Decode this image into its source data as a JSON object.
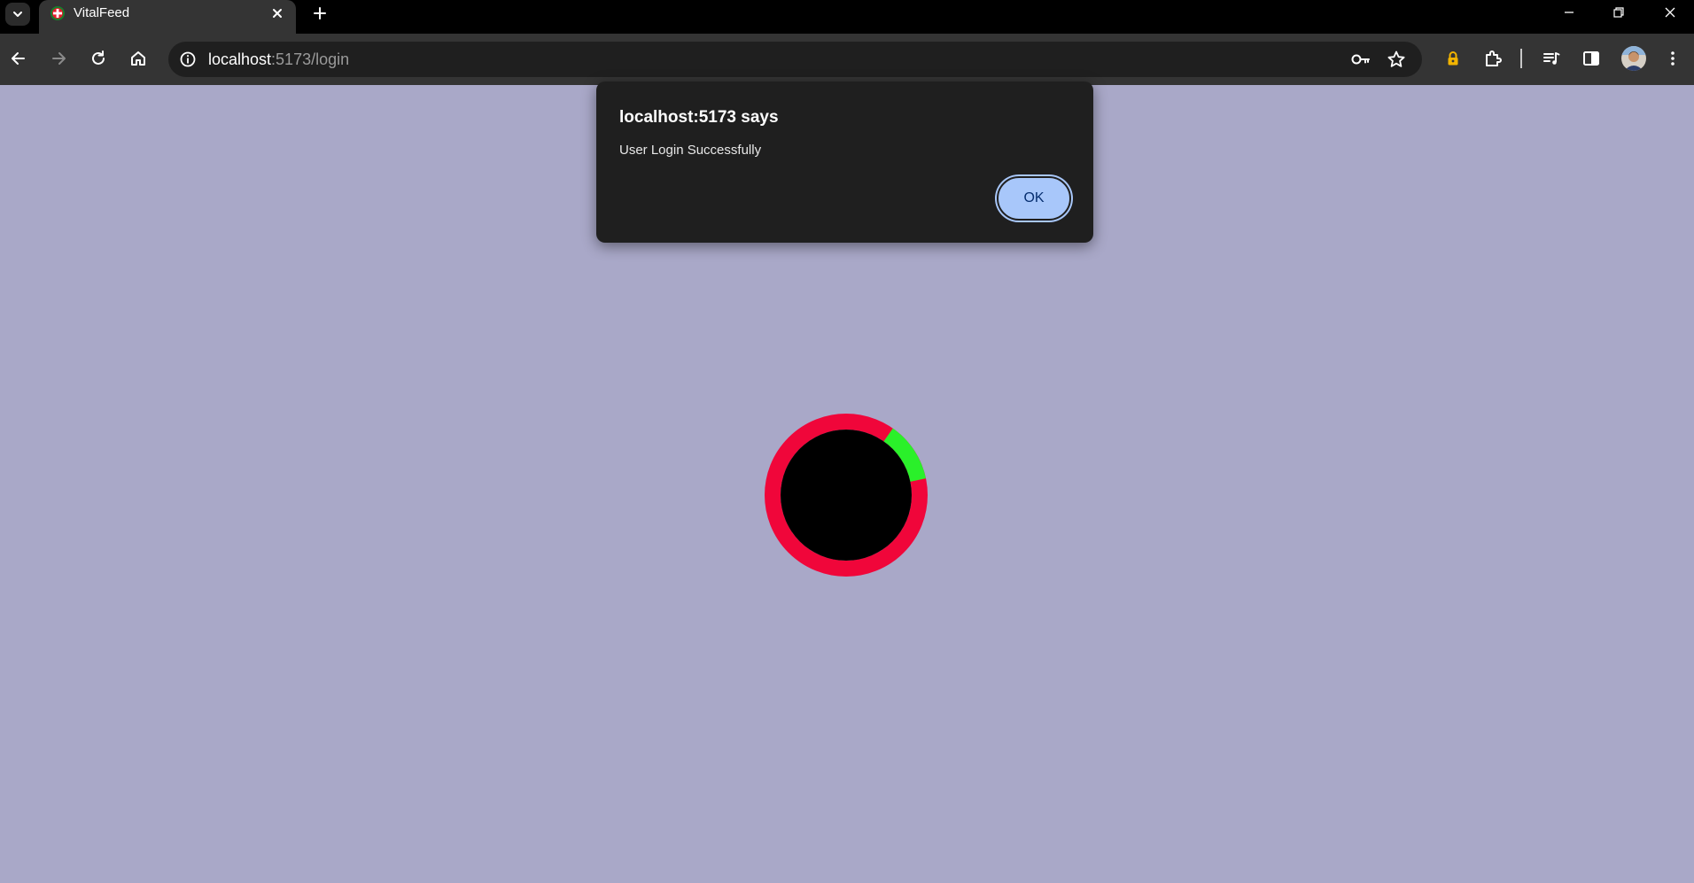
{
  "browser": {
    "tab": {
      "title": "VitalFeed",
      "favicon": "vitalfeed-plus-icon",
      "close_icon": "close-icon"
    },
    "new_tab_icon": "plus-icon",
    "tab_search_icon": "chevron-down-icon",
    "window_controls": [
      "minimize-icon",
      "restore-icon",
      "close-icon"
    ],
    "nav": {
      "back_icon": "back-arrow-icon",
      "forward_icon": "forward-arrow-icon",
      "reload_icon": "reload-icon",
      "home_icon": "home-icon"
    },
    "omnibox": {
      "host": "localhost",
      "path": ":5173/login",
      "info_icon": "site-info-icon",
      "key_icon": "password-key-icon",
      "star_icon": "bookmark-star-icon"
    },
    "toolbar_icons": [
      "lock-extension-icon",
      "extensions-puzzle-icon",
      "media-controls-icon",
      "side-panel-icon",
      "profile-avatar",
      "more-menu-icon"
    ]
  },
  "dialog": {
    "title": "localhost:5173 says",
    "message": "User Login Successfully",
    "ok_label": "OK"
  },
  "page": {
    "background": "#a9a8c8",
    "loader": {
      "ring_color": "#f0063a",
      "accent_color": "#2af02a",
      "center_color": "#000000",
      "accent_fraction": 0.12
    }
  },
  "colors": {
    "tabstrip": "#000000",
    "toolbar": "#343434",
    "omnibox": "#1f1f1f",
    "dialog_bg": "#1f1f1f",
    "ok_button": "#a8c7fa"
  }
}
